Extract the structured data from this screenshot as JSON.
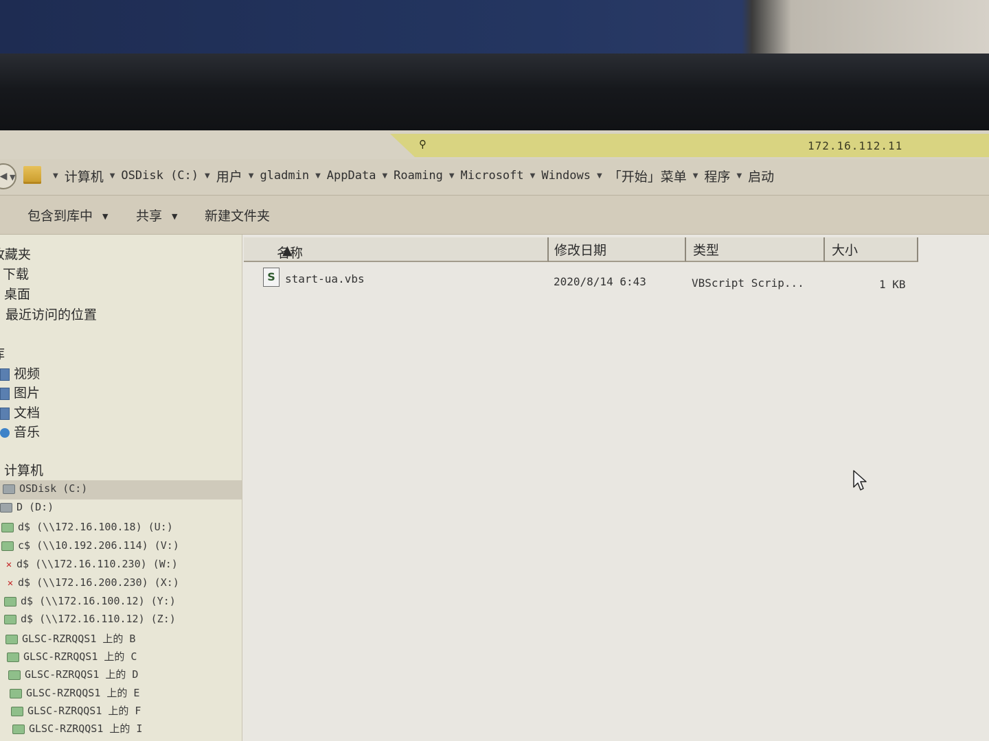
{
  "rdp": {
    "host_ip": "172.16.112.11",
    "pin_icon": "pin-icon"
  },
  "address": {
    "crumbs": [
      "计算机",
      "OSDisk (C:)",
      "用户",
      "gladmin",
      "AppData",
      "Roaming",
      "Microsoft",
      "Windows",
      "「开始」菜单",
      "程序",
      "启动"
    ]
  },
  "toolbar": {
    "include_library": "包含到库中",
    "share": "共享",
    "new_folder": "新建文件夹"
  },
  "navpane": {
    "favorites": "收藏夹",
    "downloads": "下载",
    "desktop": "桌面",
    "recent": "最近访问的位置",
    "libraries": "库",
    "videos": "视频",
    "pictures": "图片",
    "documents": "文档",
    "music": "音乐",
    "computer": "计算机",
    "drives": [
      "OSDisk (C:)",
      "D (D:)",
      "d$ (\\\\172.16.100.18) (U:)",
      "c$ (\\\\10.192.206.114) (V:)",
      "d$ (\\\\172.16.110.230) (W:)",
      "d$ (\\\\172.16.200.230) (X:)",
      "d$ (\\\\172.16.100.12) (Y:)",
      "d$ (\\\\172.16.110.12) (Z:)",
      "GLSC-RZRQQS1 上的 B",
      "GLSC-RZRQQS1 上的 C",
      "GLSC-RZRQQS1 上的 D",
      "GLSC-RZRQQS1 上的 E",
      "GLSC-RZRQQS1 上的 F",
      "GLSC-RZRQQS1 上的 I"
    ]
  },
  "columns": {
    "name": "名称",
    "modified": "修改日期",
    "type": "类型",
    "size": "大小"
  },
  "files": [
    {
      "name": "start-ua.vbs",
      "modified": "2020/8/14 6:43",
      "type": "VBScript Scrip...",
      "size": "1 KB"
    }
  ]
}
